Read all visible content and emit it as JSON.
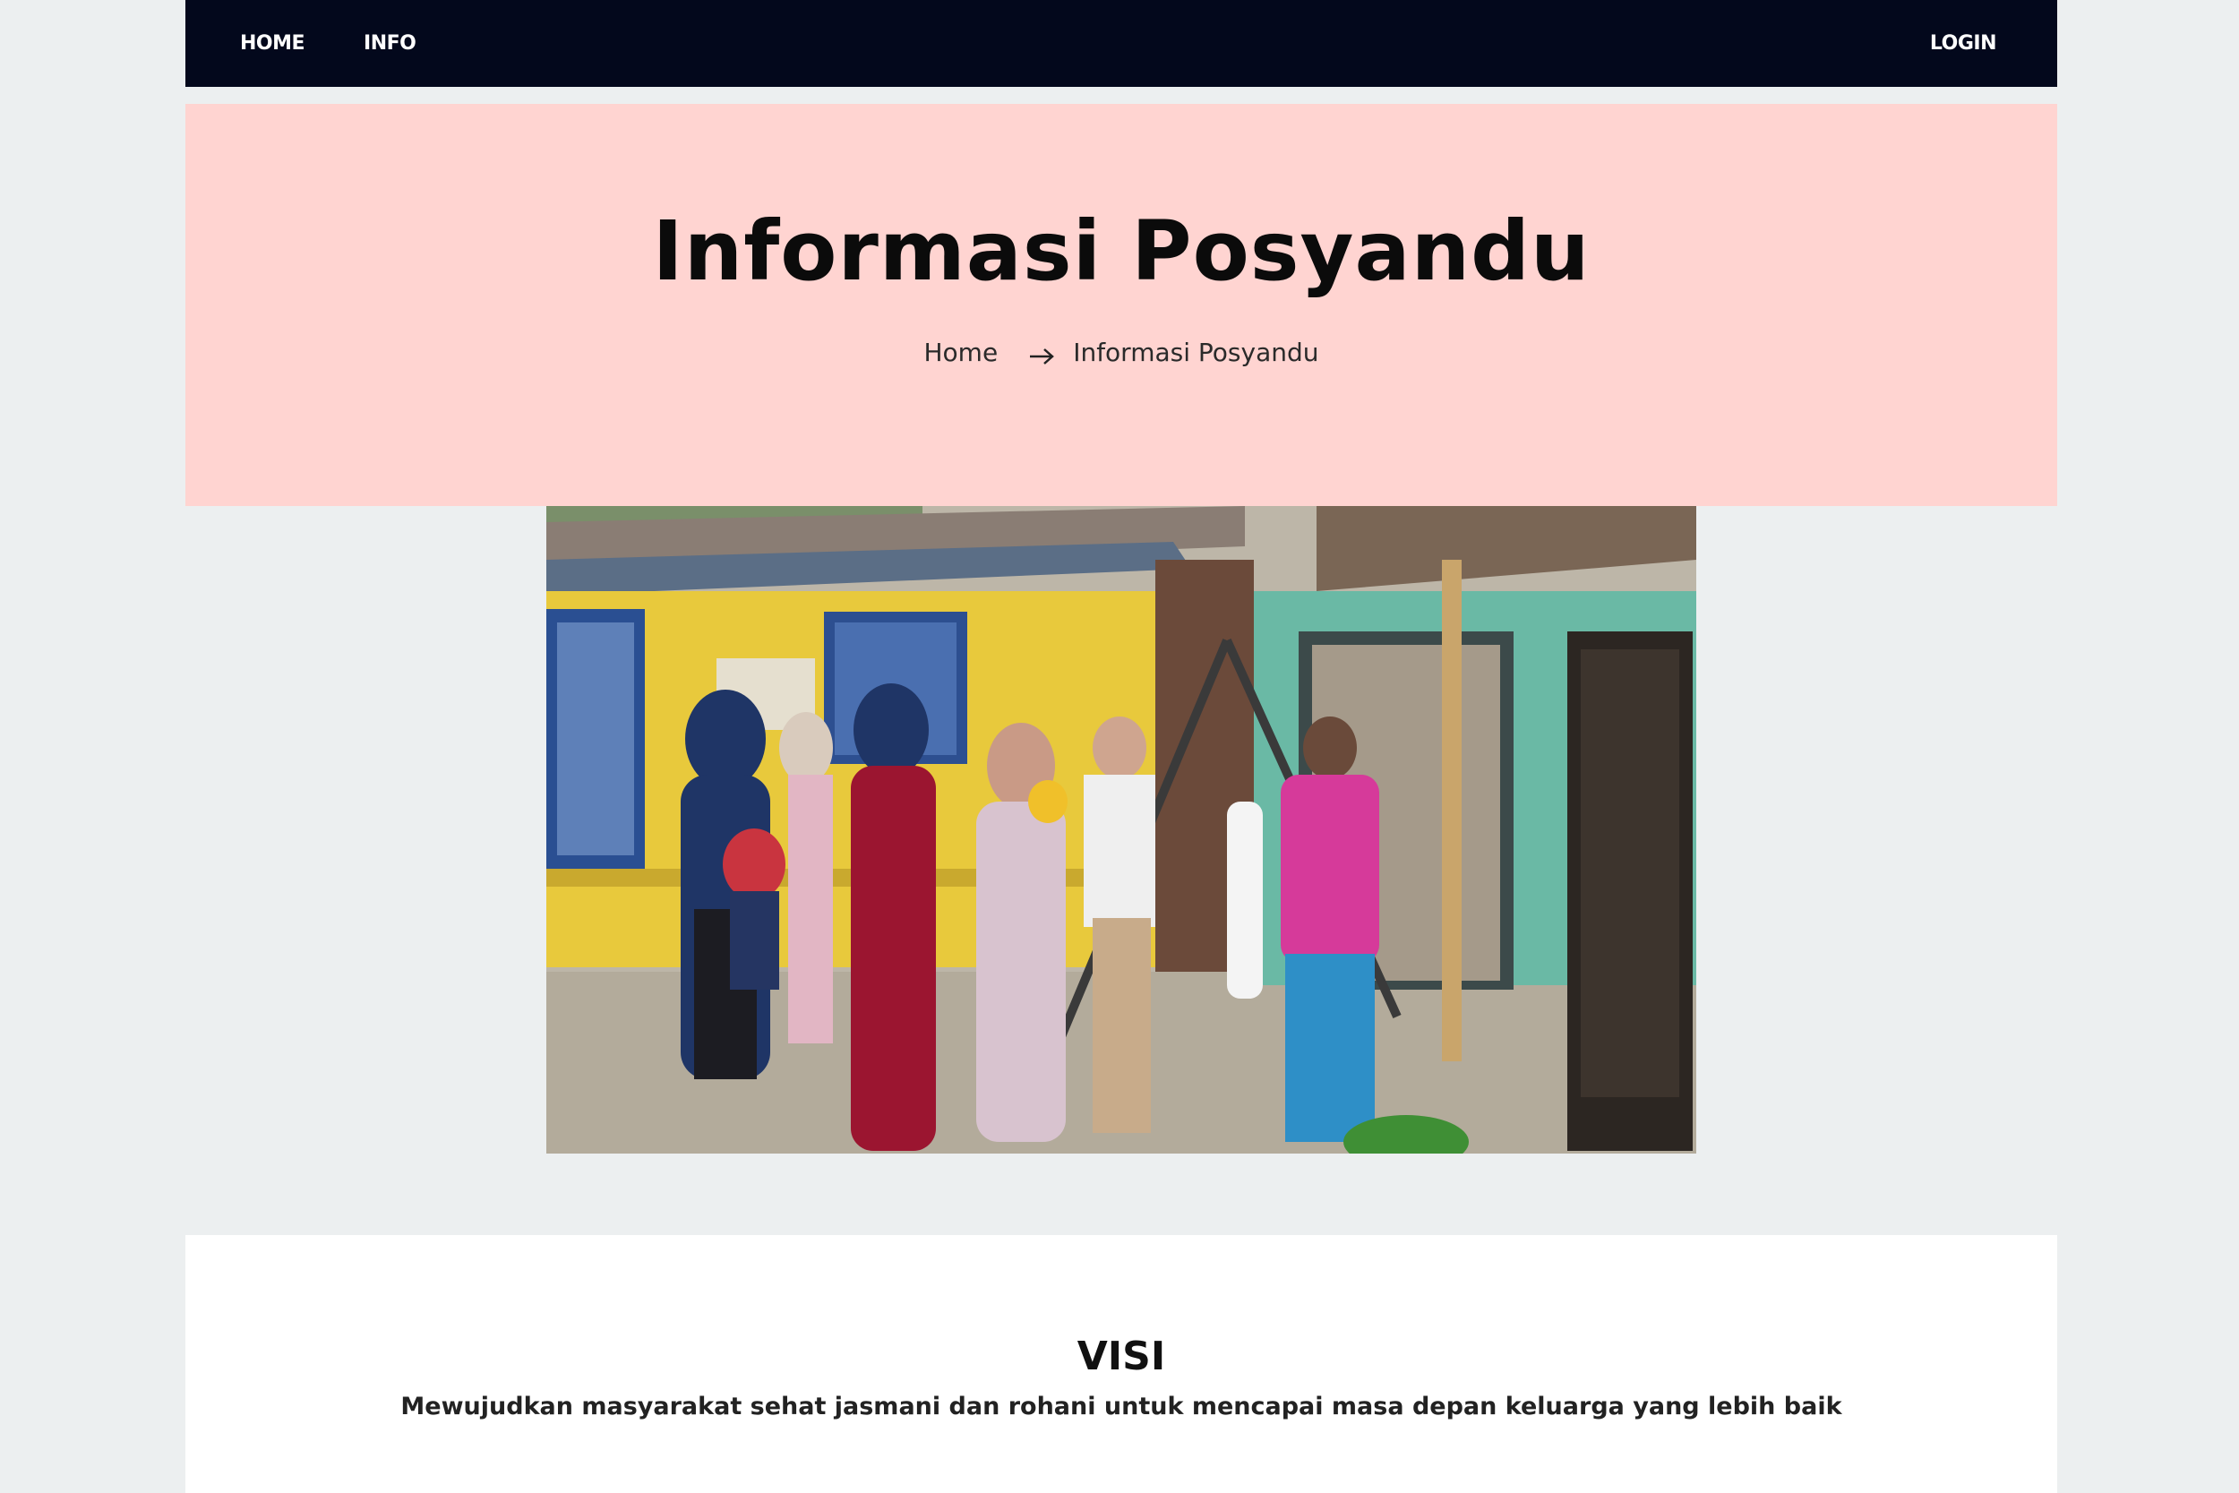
{
  "navbar": {
    "home_label": "HOME",
    "info_label": "INFO",
    "login_label": "LOGIN"
  },
  "hero": {
    "title": "Informasi Posyandu",
    "breadcrumb_home": "Home",
    "breadcrumb_current": "Informasi Posyandu"
  },
  "photo": {
    "icon": "group-photo"
  },
  "visi": {
    "title": "VISI",
    "text": "Mewujudkan masyarakat sehat jasmani dan rohani untuk mencapai masa depan keluarga yang lebih baik"
  },
  "colors": {
    "navbar_bg": "#03081c",
    "hero_bg": "#ffd4d1",
    "page_bg": "#eceff0"
  }
}
